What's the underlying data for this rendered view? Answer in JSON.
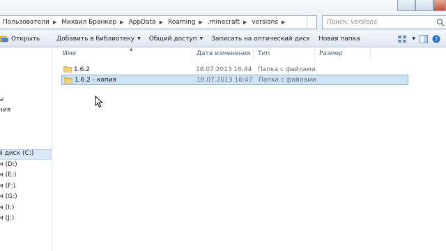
{
  "address_bar": {
    "breadcrumbs": [
      "Пользователи",
      "Михаил Бранкер",
      "AppData",
      "Roaming",
      ".minecraft",
      "versions"
    ]
  },
  "search": {
    "placeholder": "Поиск: versions"
  },
  "toolbar": {
    "open": "Открыть",
    "add_to_library": "Добавить в библиотеку",
    "share": "Общий доступ",
    "burn": "Записать на оптический диск",
    "new_folder": "Новая папка"
  },
  "columns": {
    "name": "Имя",
    "date": "Дата изменения",
    "type": "Тип",
    "size": "Размер"
  },
  "files": [
    {
      "name": "1.6.2",
      "date": "18.07.2013 16:44",
      "type": "Папка с файлами",
      "selected": false
    },
    {
      "name": "1.6.2 - копия",
      "date": "18.07.2013 16:47",
      "type": "Папка с файлами",
      "selected": true
    }
  ],
  "nav": {
    "items": [
      {
        "label": "ы"
      },
      {
        "label": "ния"
      },
      {
        "label": "й диск (C:)"
      },
      {
        "label": "м (D:)"
      },
      {
        "label": "м (E:)"
      },
      {
        "label": "м (F:)"
      },
      {
        "label": "м (G:)"
      },
      {
        "label": "м (I:)"
      },
      {
        "label": "м (J:)"
      }
    ]
  },
  "colors": {
    "selection_fill": "#cce4fa",
    "selection_border": "#7eb4ea",
    "folder": "#e8c15a"
  }
}
